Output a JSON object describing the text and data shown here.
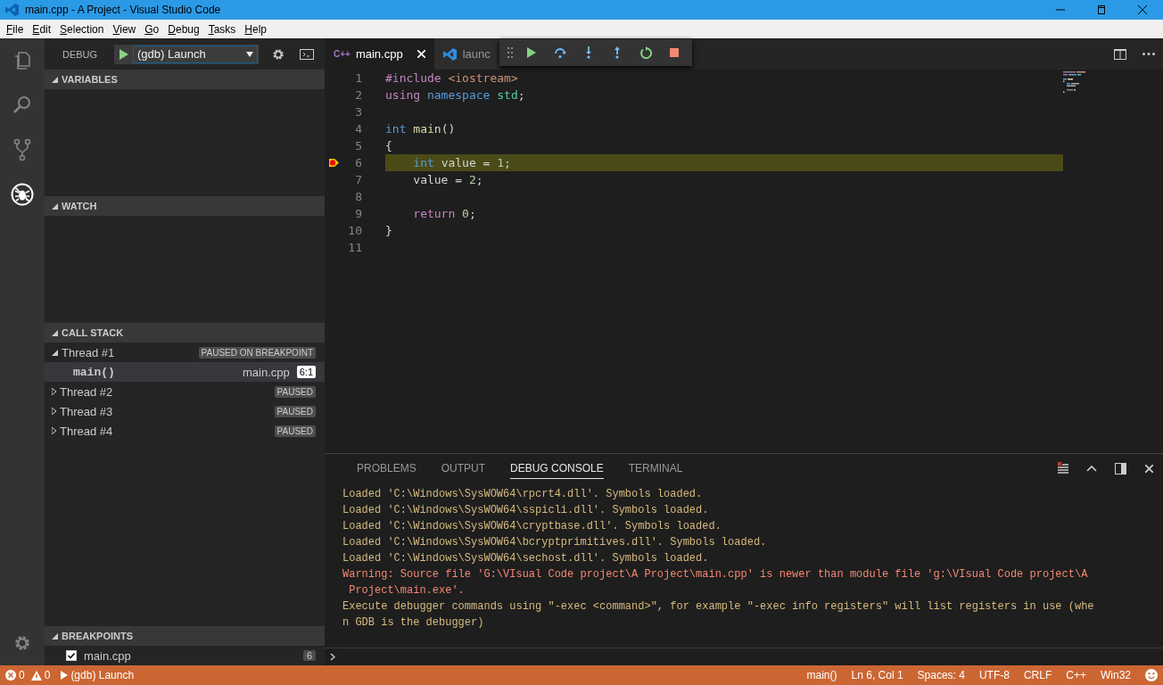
{
  "window": {
    "title": "main.cpp - A Project - Visual Studio Code"
  },
  "menu": [
    {
      "label": "File"
    },
    {
      "label": "Edit"
    },
    {
      "label": "Selection"
    },
    {
      "label": "View"
    },
    {
      "label": "Go"
    },
    {
      "label": "Debug"
    },
    {
      "label": "Tasks"
    },
    {
      "label": "Help"
    }
  ],
  "activity_bar": [
    {
      "kind": "files",
      "selected": false
    },
    {
      "kind": "search",
      "selected": false
    },
    {
      "kind": "source-control",
      "selected": false
    },
    {
      "kind": "debug",
      "selected": true
    },
    {
      "kind": "settings",
      "selected": false
    }
  ],
  "debug_bar": {
    "title": "DEBUG",
    "configuration": "(gdb) Launch"
  },
  "variables": {
    "title": "VARIABLES",
    "expanded": true
  },
  "watch": {
    "title": "WATCH",
    "expanded": true
  },
  "call_stack": {
    "title": "CALL STACK",
    "expanded": true,
    "threads": [
      {
        "label": "Thread #1",
        "status": "PAUSED ON BREAKPOINT",
        "expanded": true,
        "children": [
          {
            "label": "main()",
            "file": "main.cpp",
            "position": "6:1",
            "selected": true
          }
        ]
      },
      {
        "label": "Thread #2",
        "status": "PAUSED",
        "expanded": false
      },
      {
        "label": "Thread #3",
        "status": "PAUSED",
        "expanded": false
      },
      {
        "label": "Thread #4",
        "status": "PAUSED",
        "expanded": false
      }
    ]
  },
  "breakpoints": {
    "title": "BREAKPOINTS",
    "expanded": true,
    "items": [
      {
        "label": "main.cpp",
        "checked": true,
        "count": "6"
      }
    ]
  },
  "editor": {
    "tabs": [
      {
        "label": "main.cpp",
        "kind": "cpp",
        "badge": "C++",
        "selected": true
      },
      {
        "label": "launc",
        "kind": "vscode",
        "selected": false
      }
    ],
    "lines": [
      {
        "number": "1",
        "breakpoint": false,
        "current": false,
        "tokens": [
          {
            "text": "#include ",
            "kind": "directive"
          },
          {
            "text": "<iostream>",
            "kind": "string"
          }
        ]
      },
      {
        "number": "2",
        "breakpoint": false,
        "current": false,
        "tokens": [
          {
            "text": "using ",
            "kind": "control"
          },
          {
            "text": "namespace ",
            "kind": "keyword"
          },
          {
            "text": "std",
            "kind": "type"
          },
          {
            "text": ";",
            "kind": "plain"
          }
        ]
      },
      {
        "number": "3",
        "breakpoint": false,
        "current": false
      },
      {
        "number": "4",
        "breakpoint": false,
        "current": false,
        "tokens": [
          {
            "text": "int ",
            "kind": "keyword"
          },
          {
            "text": "main",
            "kind": "function"
          },
          {
            "text": "()",
            "kind": "plain"
          }
        ]
      },
      {
        "number": "5",
        "breakpoint": false,
        "current": false,
        "tokens": [
          {
            "text": "{",
            "kind": "plain"
          }
        ]
      },
      {
        "number": "6",
        "breakpoint": true,
        "current": true,
        "tokens": [
          {
            "text": "    int ",
            "kind": "keyword"
          },
          {
            "text": "value = ",
            "kind": "plain"
          },
          {
            "text": "1",
            "kind": "number"
          },
          {
            "text": ";",
            "kind": "plain"
          }
        ]
      },
      {
        "number": "7",
        "breakpoint": false,
        "current": false,
        "tokens": [
          {
            "text": "    value = ",
            "kind": "plain"
          },
          {
            "text": "2",
            "kind": "number"
          },
          {
            "text": ";",
            "kind": "plain"
          }
        ]
      },
      {
        "number": "8",
        "breakpoint": false,
        "current": false
      },
      {
        "number": "9",
        "breakpoint": false,
        "current": false,
        "tokens": [
          {
            "text": "    return ",
            "kind": "control"
          },
          {
            "text": "0",
            "kind": "number"
          },
          {
            "text": ";",
            "kind": "plain"
          }
        ]
      },
      {
        "number": "10",
        "breakpoint": false,
        "current": false,
        "tokens": [
          {
            "text": "}",
            "kind": "plain"
          }
        ]
      },
      {
        "number": "11",
        "breakpoint": false,
        "current": false
      }
    ]
  },
  "panel": {
    "tabs": [
      {
        "label": "PROBLEMS",
        "selected": false
      },
      {
        "label": "OUTPUT",
        "selected": false
      },
      {
        "label": "DEBUG CONSOLE",
        "selected": true
      },
      {
        "label": "TERMINAL",
        "selected": false
      }
    ],
    "console": [
      {
        "kind": "info",
        "text": "Loaded 'C:\\Windows\\SysWOW64\\rpcrt4.dll'. Symbols loaded."
      },
      {
        "kind": "info",
        "text": "Loaded 'C:\\Windows\\SysWOW64\\sspicli.dll'. Symbols loaded."
      },
      {
        "kind": "info",
        "text": "Loaded 'C:\\Windows\\SysWOW64\\cryptbase.dll'. Symbols loaded."
      },
      {
        "kind": "info",
        "text": "Loaded 'C:\\Windows\\SysWOW64\\bcryptprimitives.dll'. Symbols loaded."
      },
      {
        "kind": "info",
        "text": "Loaded 'C:\\Windows\\SysWOW64\\sechost.dll'. Symbols loaded."
      },
      {
        "kind": "warning",
        "text": "Warning: Source file 'G:\\VIsual Code project\\A Project\\main.cpp' is newer than module file 'g:\\VIsual Code project\\A"
      },
      {
        "kind": "warning",
        "text": " Project\\main.exe'."
      },
      {
        "kind": "info",
        "text": "Execute debugger commands using \"-exec <command>\", for example \"-exec info registers\" will list registers in use (whe"
      },
      {
        "kind": "info",
        "text": "n GDB is the debugger)"
      }
    ]
  },
  "status_bar": {
    "errors": "0",
    "warnings": "0",
    "launch": "(gdb) Launch",
    "items": [
      "main()",
      "Ln 6, Col 1",
      "Spaces: 4",
      "UTF-8",
      "CRLF",
      "C++",
      "Win32"
    ]
  }
}
